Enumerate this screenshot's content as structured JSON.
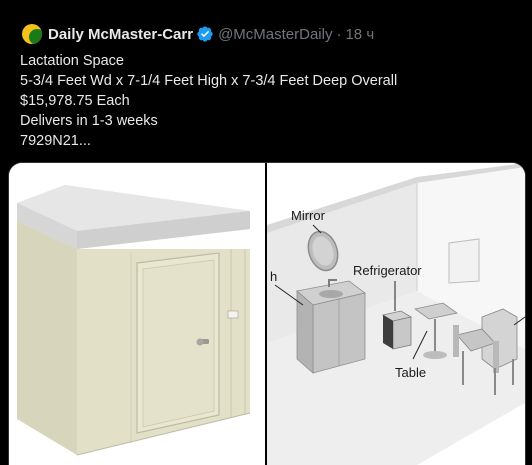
{
  "account": {
    "display_name": "Daily McMaster-Carr",
    "handle": "@McMasterDaily",
    "separator": "·",
    "time": "18 ч"
  },
  "tweet": {
    "lines": [
      "Lactation Space",
      "5-3/4 Feet Wd x 7-1/4 Feet High x 7-3/4 Feet Deep Overall",
      "$15,978.75 Each",
      "Delivers in 1-3 weeks",
      "7929N21..."
    ]
  },
  "media": {
    "diagram_labels": {
      "mirror": "Mirror",
      "refrigerator": "Refrigerator",
      "table": "Table",
      "partial_left": "h"
    }
  },
  "colors": {
    "background": "#000000",
    "text": "#e7e9ea",
    "muted": "#71767b",
    "verified": "#1d9bf0",
    "booth_wall": "#e8e6cf",
    "booth_roof": "#dcdcdc"
  },
  "icons": {
    "avatar": "mcmaster-logo",
    "verified": "verified-badge-icon"
  }
}
